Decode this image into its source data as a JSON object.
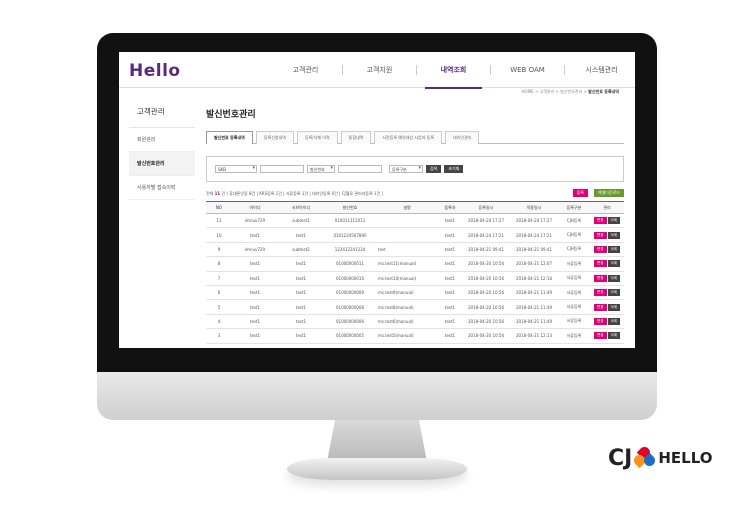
{
  "header": {
    "logo": "Hello",
    "nav": [
      "고객관리",
      "고객지원",
      "내역조회",
      "WEB OAM",
      "시스템관리"
    ]
  },
  "breadcrumb": {
    "path": "HOME > 고객관리 > 발신번호관리 > ",
    "current": "발신번호 등록내역"
  },
  "sidebar": {
    "title": "고객관리",
    "items": [
      "회원관리",
      "발신번호관리",
      "사용자별 접속이력"
    ]
  },
  "page": {
    "title": "발신번호관리"
  },
  "tabs": [
    "발신번호 등록내역",
    "등록신청내역",
    "등록/삭제 이력",
    "통합내역",
    "사전등록 예외대상 사업자 등록",
    "대리인관리"
  ],
  "search": {
    "type_select": "SKB",
    "number_select": "발신번호",
    "status_select": "등록구분",
    "search_btn": "검색",
    "reset_btn": "초기화"
  },
  "summary": {
    "text_prefix": "전체 ",
    "total": "11",
    "text_suffix": " 건 ( 휴대폰인증 8건 | ARS등록 1건 | 서류등록 1건 | 대리인등록 0건 | CJ헬로 관리자등록 1건 )",
    "register_btn": "등록",
    "excel_btn": "엑셀다운로드"
  },
  "table": {
    "headers": [
      "NO",
      "아이디",
      "서브아이디",
      "발신번호",
      "설명",
      "등록자",
      "등록일시",
      "적용일시",
      "등록구분",
      "관리"
    ],
    "edit_label": "변경",
    "delete_label": "삭제",
    "rows": [
      [
        "11",
        "ehnuv729",
        "subtest1",
        "010011112011",
        "",
        "test1",
        "2018-04-24 17:27",
        "2018-04-24 17:27",
        "CJH등록"
      ],
      [
        "10",
        "test1",
        "test1",
        "0101234567890",
        "",
        "test1",
        "2018-04-24 17:21",
        "2018-04-24 17:21",
        "CJH등록"
      ],
      [
        "9",
        "ehnuv729",
        "subtest2",
        "123412341234",
        "test",
        "test1",
        "2018-04-21 09:41",
        "2018-04-21 09:41",
        "CJH등록"
      ],
      [
        "8",
        "test1",
        "test1",
        "01000000011",
        "ms.test11(manual)",
        "test1",
        "2018-04-20 10:56",
        "2018-04-21 12:07",
        "서류등록"
      ],
      [
        "7",
        "test1",
        "test1",
        "01000000010",
        "ms.test10(manual)",
        "test1",
        "2018-04-20 10:56",
        "2018-04-21 12:16",
        "서류등록"
      ],
      [
        "6",
        "test1",
        "test1",
        "01000000009",
        "ms.test9(manual)",
        "test1",
        "2018-04-20 10:56",
        "2018-04-21 11:49",
        "서류등록"
      ],
      [
        "5",
        "test1",
        "test1",
        "01000000008",
        "ms.test8(manual)",
        "test1",
        "2018-04-20 10:56",
        "2018-04-21 11:49",
        "서류등록"
      ],
      [
        "4",
        "test1",
        "test1",
        "01000000006",
        "ms.test6(manual)",
        "test1",
        "2018-04-20 10:56",
        "2018-04-21 11:49",
        "서류등록"
      ],
      [
        "3",
        "test1",
        "test1",
        "01000000005",
        "ms.test5(manual)",
        "test1",
        "2018-04-20 10:56",
        "2018-04-21 12:13",
        "서류등록"
      ]
    ]
  },
  "brand": {
    "cj": "CJ",
    "hello": "HELLO"
  },
  "colors": {
    "brand_purple": "#5b2a79",
    "pink": "#e1007a",
    "green": "#6a9a2b"
  }
}
